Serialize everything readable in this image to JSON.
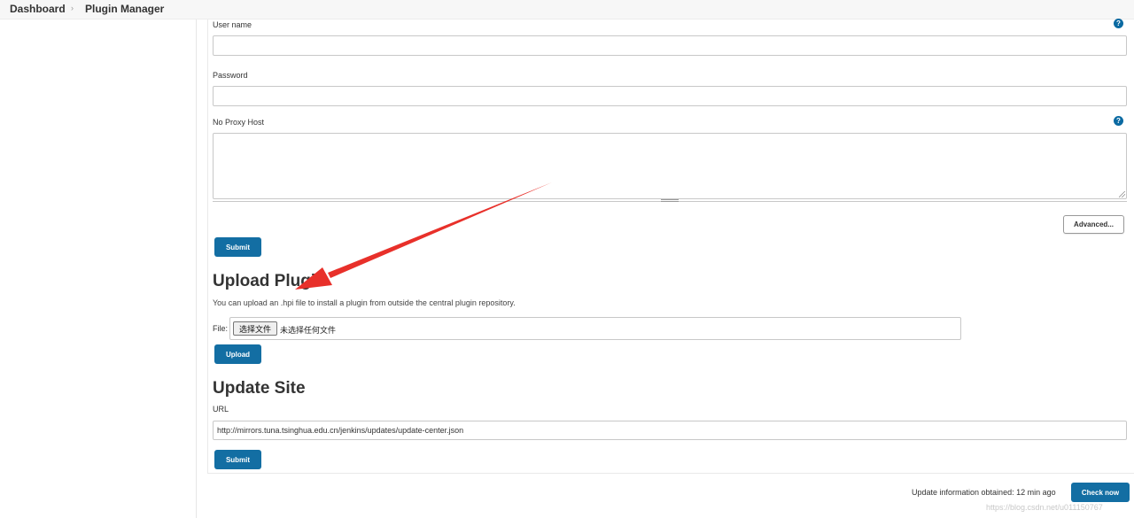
{
  "breadcrumb": {
    "items": [
      "Dashboard",
      "Plugin Manager"
    ],
    "separator": "›"
  },
  "proxy_form": {
    "username_label": "User name",
    "username_value": "",
    "password_label": "Password",
    "password_value": "",
    "no_proxy_host_label": "No Proxy Host",
    "no_proxy_host_value": "",
    "help_icon_glyph": "?",
    "advanced_button": "Advanced...",
    "submit_button": "Submit"
  },
  "upload_plugin": {
    "title": "Upload Plugin",
    "description": "You can upload an .hpi file to install a plugin from outside the central plugin repository.",
    "file_label": "File:",
    "choose_file_button": "选择文件",
    "no_file_text": "未选择任何文件",
    "upload_button": "Upload"
  },
  "update_site": {
    "title": "Update Site",
    "url_label": "URL",
    "url_value": "http://mirrors.tuna.tsinghua.edu.cn/jenkins/updates/update-center.json",
    "submit_button": "Submit"
  },
  "footer": {
    "status_text": "Update information obtained: 12 min ago",
    "check_now_button": "Check now",
    "watermark": "https://blog.csdn.net/u011150767"
  },
  "colors": {
    "primary_button": "#136ea3",
    "help_icon": "#0b6aa2",
    "annotation_arrow": "#e8302a"
  },
  "icons": {
    "help": "help-icon",
    "breadcrumb_separator": "chevron-right-icon",
    "annotation": "red-arrow-annotation"
  }
}
